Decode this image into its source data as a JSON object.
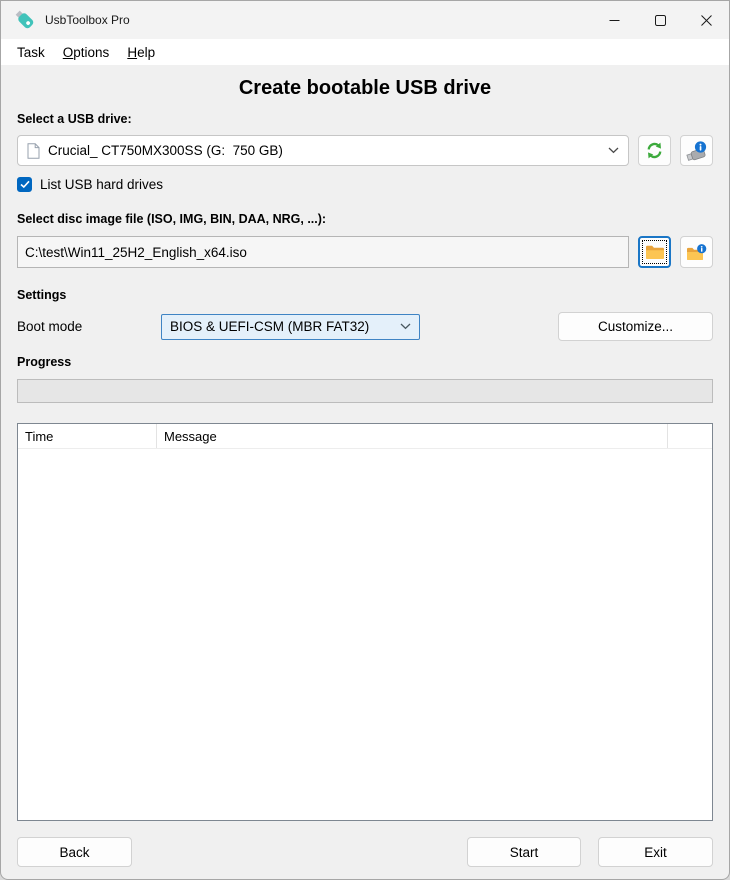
{
  "window": {
    "title": "UsbToolbox Pro",
    "app_icon": "teal-usb-flash-drive"
  },
  "menu": {
    "items": [
      {
        "label": "Task"
      },
      {
        "label": "Options"
      },
      {
        "label": "Help"
      }
    ]
  },
  "main": {
    "heading": "Create bootable USB drive",
    "usb_section": {
      "label": "Select a USB drive:",
      "selected_drive": "Crucial_ CT750MX300SS (G:  750 GB)",
      "drive_icon": "document-icon",
      "refresh_icon": "refresh-arrows-icon",
      "drive_info_icon": "usb-drive-info-icon",
      "checkbox_label": "List USB hard drives",
      "checkbox_checked": true
    },
    "image_section": {
      "label": "Select disc image file (ISO, IMG, BIN, DAA, NRG, ...):",
      "file_path": "C:\\test\\Win11_25H2_English_x64.iso",
      "browse_icon": "folder-icon",
      "image_info_icon": "folder-info-icon"
    },
    "settings": {
      "heading": "Settings",
      "boot_mode_label": "Boot mode",
      "boot_mode_value": "BIOS & UEFI-CSM (MBR FAT32)",
      "customize_label": "Customize..."
    },
    "progress": {
      "heading": "Progress",
      "value_percent": 0
    },
    "log": {
      "columns": [
        "Time",
        "Message"
      ],
      "rows": []
    },
    "footer": {
      "back_label": "Back",
      "start_label": "Start",
      "exit_label": "Exit"
    }
  },
  "colors": {
    "accent_blue": "#0067c0",
    "select_border": "#3f84c4",
    "select_bg": "#e4f0fa",
    "refresh_green": "#3caa3c",
    "folder_yellow": "#fcc553",
    "badge_blue": "#1673d1",
    "app_icon_teal": "#41c3ba",
    "titlebar_bg": "#f3f3f3",
    "content_bg": "#f0f0f0"
  }
}
